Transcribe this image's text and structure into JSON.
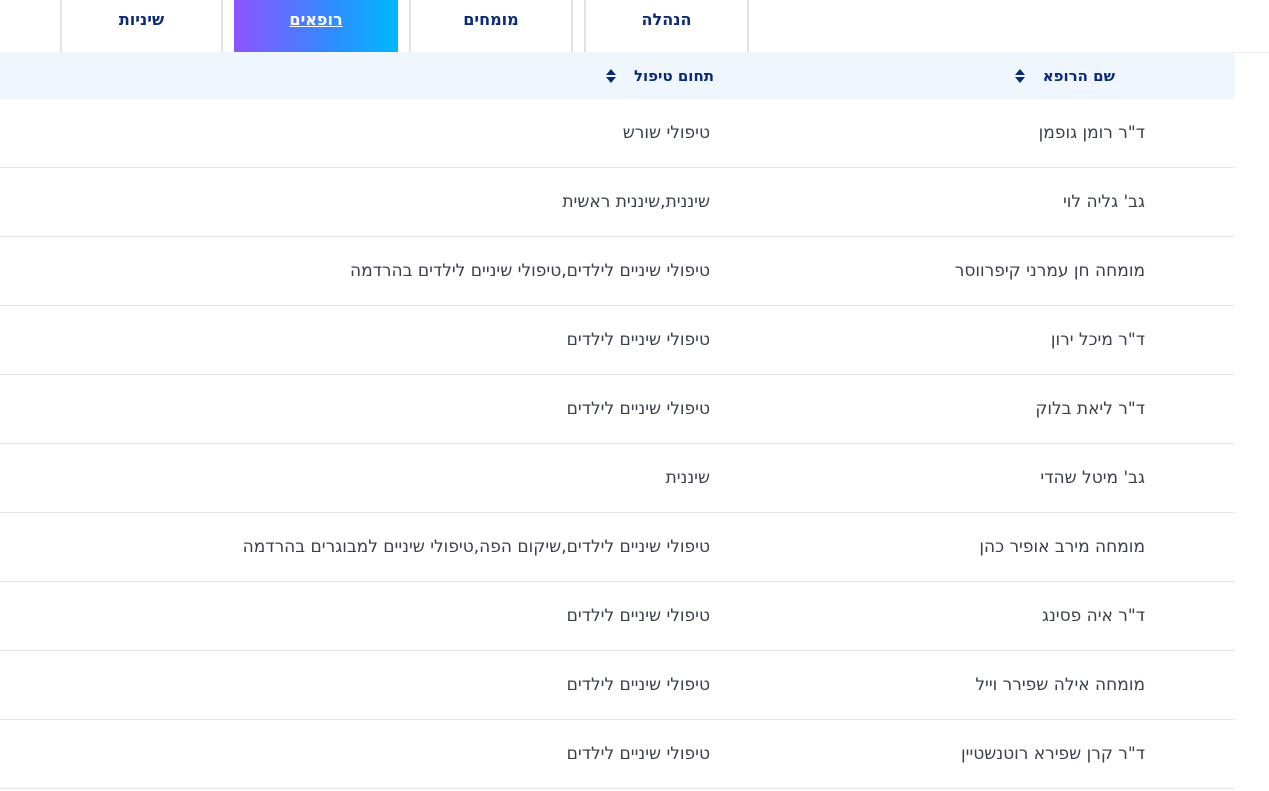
{
  "tabs": [
    {
      "label": "שיניות",
      "active": false
    },
    {
      "label": "רופאים",
      "active": true
    },
    {
      "label": "מומחים",
      "active": false
    },
    {
      "label": "הנהלה",
      "active": false
    }
  ],
  "table": {
    "headers": {
      "name": "שם הרופא",
      "field": "תחום טיפול"
    },
    "rows": [
      {
        "name": "ד\"ר רומן גופמן",
        "field": "טיפולי שורש"
      },
      {
        "name": "גב' גליה לוי",
        "field": "שיננית,שיננית ראשית"
      },
      {
        "name": "מומחה חן עמרני קיפרווסר",
        "field": "טיפולי שיניים לילדים,טיפולי שיניים לילדים בהרדמה"
      },
      {
        "name": "ד\"ר מיכל ירון",
        "field": "טיפולי שיניים לילדים"
      },
      {
        "name": "ד\"ר ליאת בלוק",
        "field": "טיפולי שיניים לילדים"
      },
      {
        "name": "גב' מיטל שהדי",
        "field": "שיננית"
      },
      {
        "name": "מומחה מירב אופיר כהן",
        "field": "טיפולי שיניים לילדים,שיקום הפה,טיפולי שיניים למבוגרים בהרדמה"
      },
      {
        "name": "ד\"ר איה פסינג",
        "field": "טיפולי שיניים לילדים"
      },
      {
        "name": "מומחה אילה שפירר וייל",
        "field": "טיפולי שיניים לילדים"
      },
      {
        "name": "ד\"ר קרן שפירא רוטנשטיין",
        "field": "טיפולי שיניים לילדים"
      }
    ]
  },
  "colors": {
    "heading": "#0b2a7a",
    "header_bg": "#eff6fd",
    "active_tab_gradient": [
      "#8b55ff",
      "#00b7ff"
    ]
  }
}
